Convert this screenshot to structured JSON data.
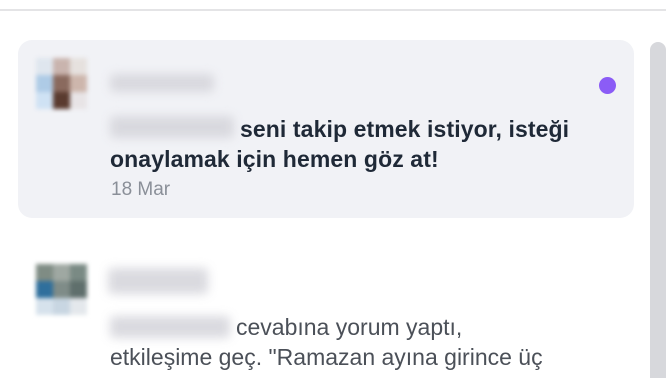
{
  "notifications": [
    {
      "line1_suffix": "seni takip etmek istiyor, isteği",
      "line2": "onaylamak için hemen göz at!",
      "date": "18 Mar",
      "unread": true,
      "unread_color": "#8b5cf6"
    },
    {
      "line1_suffix": "cevabına yorum yaptı,",
      "line2": "etkileşime geç. \"Ramazan ayına girince üç",
      "unread": false
    }
  ],
  "colors": {
    "unread_background": "#f1f2f6",
    "accent": "#8b5cf6"
  },
  "icons": [
    "avatar",
    "unread-dot-icon"
  ]
}
